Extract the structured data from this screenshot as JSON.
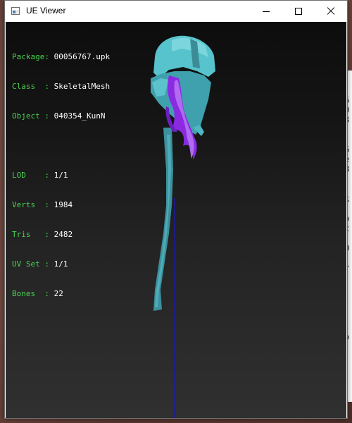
{
  "window": {
    "title": "UE Viewer"
  },
  "info": {
    "rows": [
      {
        "label": "Package: ",
        "value": "00056767.upk"
      },
      {
        "label": "Class  : ",
        "value": "SkeletalMesh"
      },
      {
        "label": "Object : ",
        "value": "040354_KunN"
      },
      {
        "label": "LOD    : ",
        "value": "1/1"
      },
      {
        "label": "Verts  : ",
        "value": "1984"
      },
      {
        "label": "Tris   : ",
        "value": "2482"
      },
      {
        "label": "UV Set : ",
        "value": "1/1"
      },
      {
        "label": "Bones  : ",
        "value": "22"
      }
    ]
  },
  "background_window": {
    "chars": [
      "6",
      "0",
      "3",
      "6",
      "e",
      "8",
      "k",
      "o",
      "c",
      "O",
      "(",
      "r",
      "-",
      "o"
    ]
  },
  "colors": {
    "info_label": "#47d24f",
    "info_value": "#ffffff",
    "mesh_teal": "#4fb7c2",
    "mesh_hair": "#8a2be2",
    "axis_line": "#1a1aa0"
  },
  "icons": {
    "app": "app-window-icon",
    "minimize": "minimize-icon",
    "maximize": "maximize-icon",
    "close": "close-icon"
  }
}
